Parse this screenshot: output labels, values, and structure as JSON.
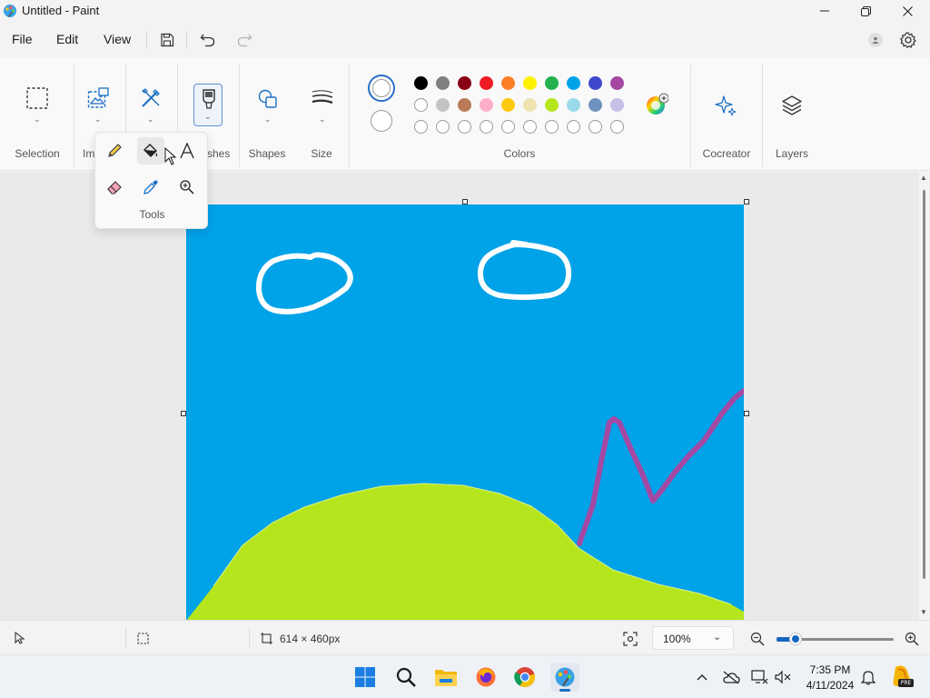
{
  "window": {
    "title": "Untitled - Paint",
    "minimize_icon": "minimize-icon",
    "restore_icon": "restore-icon",
    "close_icon": "close-icon"
  },
  "menu": {
    "file": "File",
    "edit": "Edit",
    "view": "View"
  },
  "ribbon": {
    "groups": {
      "selection": "Selection",
      "image": "Im",
      "brushes": "shes",
      "shapes": "Shapes",
      "size": "Size",
      "colors": "Colors",
      "cocreator": "Cocreator",
      "layers": "Layers"
    },
    "palette": {
      "row1": [
        "#000000",
        "#7f7f7f",
        "#880015",
        "#ed1c24",
        "#ff7f27",
        "#fff200",
        "#22b14c",
        "#00a2e8",
        "#3f48cc",
        "#a349a4"
      ],
      "row2": [
        "#ffffff",
        "#c3c3c3",
        "#b97a57",
        "#ffaec9",
        "#ffc90e",
        "#efe4b0",
        "#b5e61d",
        "#99d9ea",
        "#7092be",
        "#c8bfe7"
      ],
      "row3_empty_count": 10
    },
    "primary_color": "#ffffff",
    "secondary_color": "#ffffff"
  },
  "tools_flyout": {
    "label": "Tools",
    "items": [
      "pencil-icon",
      "fill-bucket-icon",
      "text-icon",
      "eraser-icon",
      "color-picker-icon",
      "magnifier-icon"
    ],
    "selected": "fill-bucket-icon"
  },
  "canvas": {
    "background": "#00a2e8",
    "hill_color": "#b5e61d",
    "stroke_colors": {
      "clouds": "#ffffff",
      "line": "#a349a4"
    }
  },
  "status": {
    "canvas_size": "614 × 460px",
    "zoom": "100%",
    "zoom_level_fraction": 0.14
  },
  "taskbar": {
    "time": "7:35 PM",
    "date": "4/11/2024",
    "apps": [
      "windows-start-icon",
      "search-icon",
      "file-explorer-icon",
      "firefox-icon",
      "chrome-icon",
      "paint-icon"
    ],
    "copilot_badge": "PRE"
  }
}
